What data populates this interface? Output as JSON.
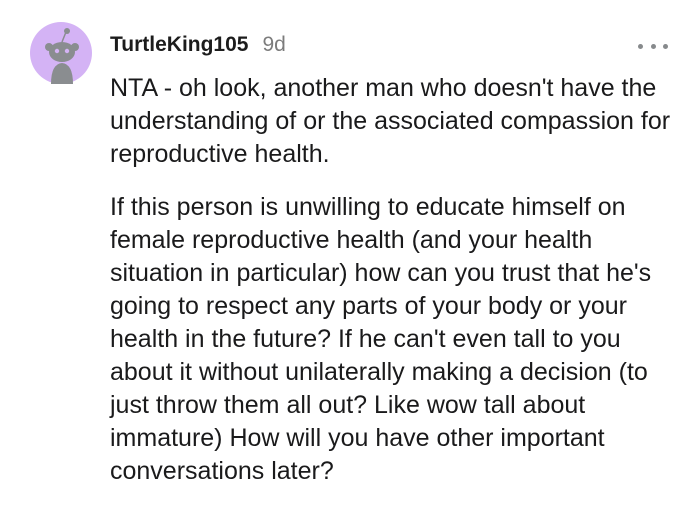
{
  "comment": {
    "username": "TurtleKing105",
    "age": "9d",
    "avatar_icon": "snoo-avatar-icon",
    "avatar_bg": "#d4b3f5",
    "more_icon": "more-options-icon",
    "paragraphs": [
      "NTA - oh look, another man who doesn't have the understanding of or the associated compassion for reproductive health.",
      "If this person is unwilling to educate himself on female reproductive health (and your health situation in particular) how can you trust that he's going to respect any parts of your body or your health in the future? If he can't even tall to you about it without unilaterally making a decision (to just throw them all out? Like wow tall about immature) How will you have other important conversations later?"
    ]
  }
}
